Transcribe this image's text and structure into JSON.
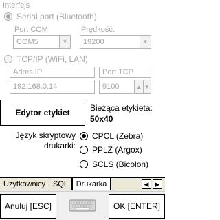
{
  "section": {
    "title": "Interfejs"
  },
  "serial": {
    "label": "Serial port (Bluetooth)",
    "port_label": "Port COM:",
    "port_value": "COM5",
    "speed_label": "Prędkość:",
    "speed_value": "19200"
  },
  "tcp": {
    "label": "TCP/IP (WiFi, LAN)",
    "ip_label": "Adres IP",
    "ip_value": "192.168.0.14",
    "port_label": "Port TCP",
    "port_value": "9100"
  },
  "labels": {
    "editor_button": "Edytor etykiet",
    "current_label_caption": "Bieżąca etykieta:",
    "current_label_value": "50x40"
  },
  "script_lang": {
    "caption_line1": "Język skryptowy",
    "caption_line2": "drukarki:",
    "options": [
      {
        "label": "CPCL (Zebra)",
        "checked": true
      },
      {
        "label": "PPLZ (Argox)",
        "checked": false
      },
      {
        "label": "SCLS (Bicolon)",
        "checked": false
      }
    ]
  },
  "tabs": [
    {
      "label": "Użytkownicy"
    },
    {
      "label": "SQL"
    },
    {
      "label": "Drukarka"
    }
  ],
  "nav": {
    "left": "◀",
    "right": "▶"
  },
  "footer": {
    "cancel": "Anuluj [ESC]",
    "ok": "OK [ENTER]"
  },
  "icons": {
    "combo_arrow": "▼",
    "spin_up": "▲",
    "spin_down": "▼"
  }
}
